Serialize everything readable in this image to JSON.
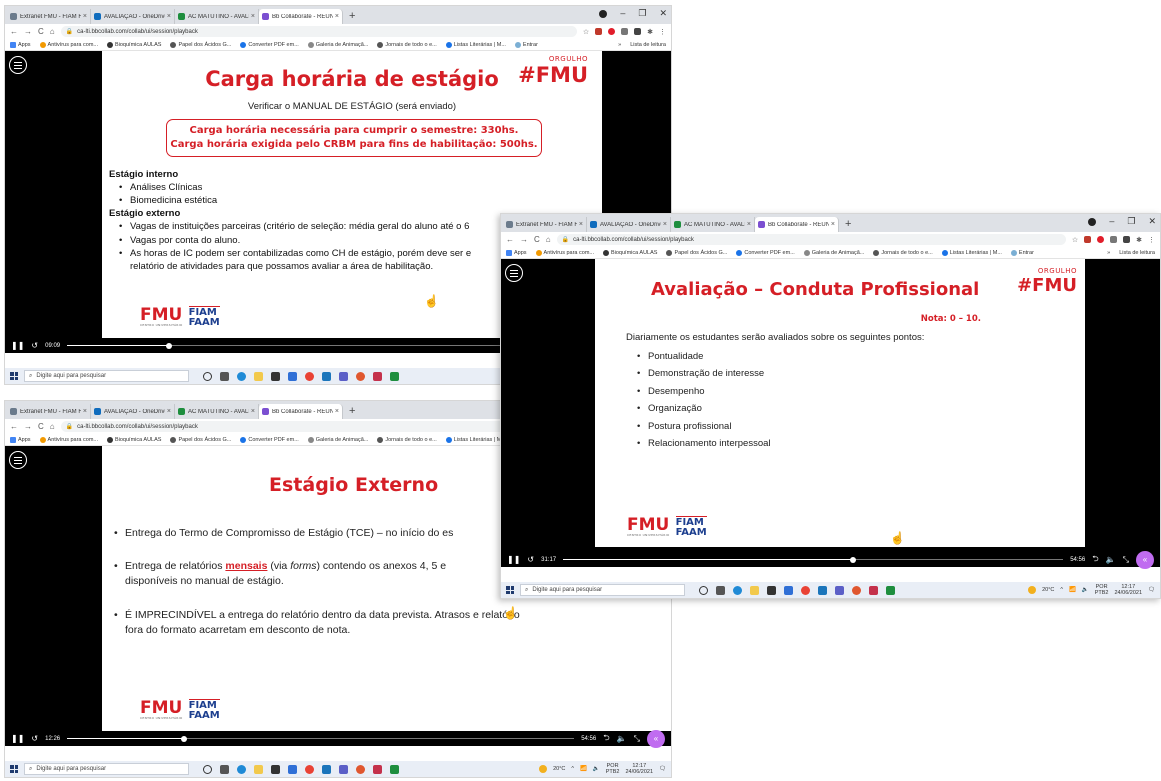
{
  "colors": {
    "brand_red": "#d51f26",
    "brand_blue": "#1d3f8f",
    "player_accent": "#c06cf0"
  },
  "browser": {
    "tabs": [
      {
        "label": "Extranet FMU - FIAM FAAM - P",
        "icon": "extranet-icon",
        "color": "#6b7b8c"
      },
      {
        "label": "AVALIAÇÃO - OneDrive",
        "icon": "onedrive-icon",
        "color": "#0f6cbd"
      },
      {
        "label": "AC MATUTINO - AVALIAÇÃO 20",
        "icon": "sheets-icon",
        "color": "#1e8e3e"
      },
      {
        "label": "Bb Collaborate - REUNIÃO",
        "icon": "blackboard-icon",
        "color": "#7b4fd1"
      }
    ],
    "new_tab": "+",
    "url": "ca-lti.bbcollab.com/collab/ui/session/playback",
    "bookmarks": [
      {
        "label": "Apps",
        "color": "#4285f4"
      },
      {
        "label": "Antivírus para com...",
        "color": "#f29900"
      },
      {
        "label": "Bioquímica AULAS",
        "color": "#333333"
      },
      {
        "label": "Papel dos Ácidos G...",
        "color": "#555555"
      },
      {
        "label": "Converter PDF em...",
        "color": "#1a73e8"
      },
      {
        "label": "Galeria de Animaçã...",
        "color": "#888888"
      },
      {
        "label": "Jornais de todo o e...",
        "color": "#555555"
      },
      {
        "label": "Listas Literárias | M...",
        "color": "#1a73e8"
      },
      {
        "label": "Entrar",
        "color": "#7bafd4"
      }
    ],
    "reading_list": "Lista de leitura",
    "more_bookmarks": "»"
  },
  "taskbar": {
    "search_placeholder": "Digite aqui para pesquisar",
    "weather": "20°C",
    "lang": "POR",
    "layout": "PTB2",
    "time": "12:17",
    "date": "24/06/2021"
  },
  "screens": [
    {
      "hashtag_small": "ORGULHO",
      "hashtag_big": "#FMU",
      "title": "Carga horária de estágio",
      "subtitle": "Verificar o MANUAL DE ESTÁGIO (será enviado)",
      "box_line1": "Carga horária necessária para cumprir o semestre: 330hs.",
      "box_line2": "Carga horária exigida pelo CRBM para fins de habilitação: 500hs.",
      "internal_heading": "Estágio interno",
      "internal_items": [
        "Análises Clínicas",
        "Biomedicina estética"
      ],
      "external_heading": "Estágio externo",
      "external_items": [
        "Vagas de instituições parceiras (critério de seleção: média geral do aluno até o 6",
        "Vagas por conta do aluno.",
        "As horas de IC podem ser contabilizadas como CH de estágio, porém deve ser e relatório de atividades para que possamos avaliar a área de habilitação."
      ],
      "logo_fmu": "FMU",
      "logo_fmu_sub": "CENTRO UNIVERSITÁRIO",
      "logo_fiam1": "FIAM",
      "logo_fiam2": "FAAM",
      "elapsed": "09:09",
      "progress": 0.17
    },
    {
      "title": "Estágio Externo",
      "bullet1": "Entrega do Termo de Compromisso de Estágio (TCE) – no início do es",
      "bullet2_a": "Entrega de relatórios ",
      "bullet2_u": "mensais",
      "bullet2_b": " (via ",
      "bullet2_i": "forms",
      "bullet2_c": ") contendo os anexos 4, 5 e",
      "bullet2_d": "disponíveis no manual de estágio.",
      "bullet3": "É IMPRECINDÍVEL a entrega do relatório dentro da data prevista. Atrasos e relatório fora do formato acarretam em desconto de nota.",
      "logo_fmu": "FMU",
      "logo_fmu_sub": "CENTRO UNIVERSITÁRIO",
      "logo_fiam1": "FIAM",
      "logo_fiam2": "FAAM",
      "elapsed": "12:26",
      "total": "54:56",
      "progress": 0.23
    },
    {
      "hashtag_small": "ORGULHO",
      "hashtag_big": "#FMU",
      "title": "Avaliação – Conduta Profissional",
      "grade": "Nota: 0 – 10.",
      "intro": "Diariamente os estudantes serão avaliados sobre os seguintes pontos:",
      "items": [
        "Pontualidade",
        "Demonstração de interesse",
        "Desempenho",
        "Organização",
        "Postura profissional",
        "Relacionamento interpessoal"
      ],
      "logo_fmu": "FMU",
      "logo_fmu_sub": "CENTRO UNIVERSITÁRIO",
      "logo_fiam1": "FIAM",
      "logo_fiam2": "FAAM",
      "elapsed": "31:17",
      "total": "54:56",
      "progress": 0.58
    }
  ]
}
